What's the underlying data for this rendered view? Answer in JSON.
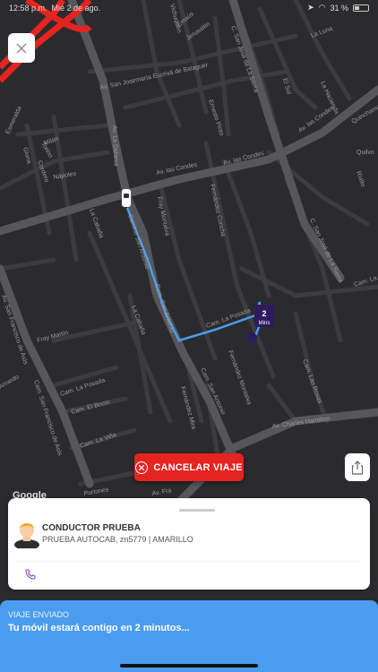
{
  "status_bar": {
    "time": "12:58 p.m.",
    "date": "Mié 2 de ago.",
    "battery": "31 %"
  },
  "map": {
    "streets": [
      "Av. La Dehesa",
      "Av. las Condes",
      "Av. las Condes",
      "Av. las Condes",
      "Av. San Josemaría Escrivá de Balaguer",
      "Camino San Antonio",
      "Cam. San Antonio",
      "Cam. San Antonio",
      "Cam. La Posada",
      "Cam. La Posada",
      "Fray Montalva",
      "Fernández Concha",
      "C. San José de La Sierra",
      "C. San José de La Sierra",
      "Av. Charles Hamilton",
      "Cam. San Francisco de Asís",
      "Av. San Francisco de Asís",
      "La Cabaña",
      "La Cabaña",
      "Fray Martín",
      "Cam. El Bocio",
      "Cam. La Viña",
      "Cam. Las Rosas",
      "Cam. La",
      "Quinchamalí",
      "Quilvo",
      "Rialto",
      "Nápoles",
      "Milán",
      "Torino",
      "Esmeralda",
      "Gloria",
      "Emaús",
      "Jerusalén",
      "Vichuquén",
      "La Luna",
      "El Sol",
      "La Hacienda",
      "Fernández Mira",
      "Fernández Montalva",
      "Ernesto Pinto",
      "Cordero",
      "Av. Fra",
      "Portones",
      "Arnardo"
    ],
    "eta_badge": {
      "value": "2",
      "unit": "Mins"
    },
    "attribution": "Google"
  },
  "close_icon": "close-icon",
  "share_icon": "share-icon",
  "cancel_button": {
    "label": "CANCELAR VIAJE",
    "color": "#e5231f"
  },
  "driver_card": {
    "name": "CONDUCTOR PRUEBA",
    "details": "PRUEBA AUTOCAB, zn5779 | AMARILLO",
    "phone_icon": "phone-icon"
  },
  "trip_status": {
    "label": "VIAJE ENVIADO",
    "message": "Tu móvil estará contigo en 2 minutos...",
    "color": "#4a9cef"
  }
}
